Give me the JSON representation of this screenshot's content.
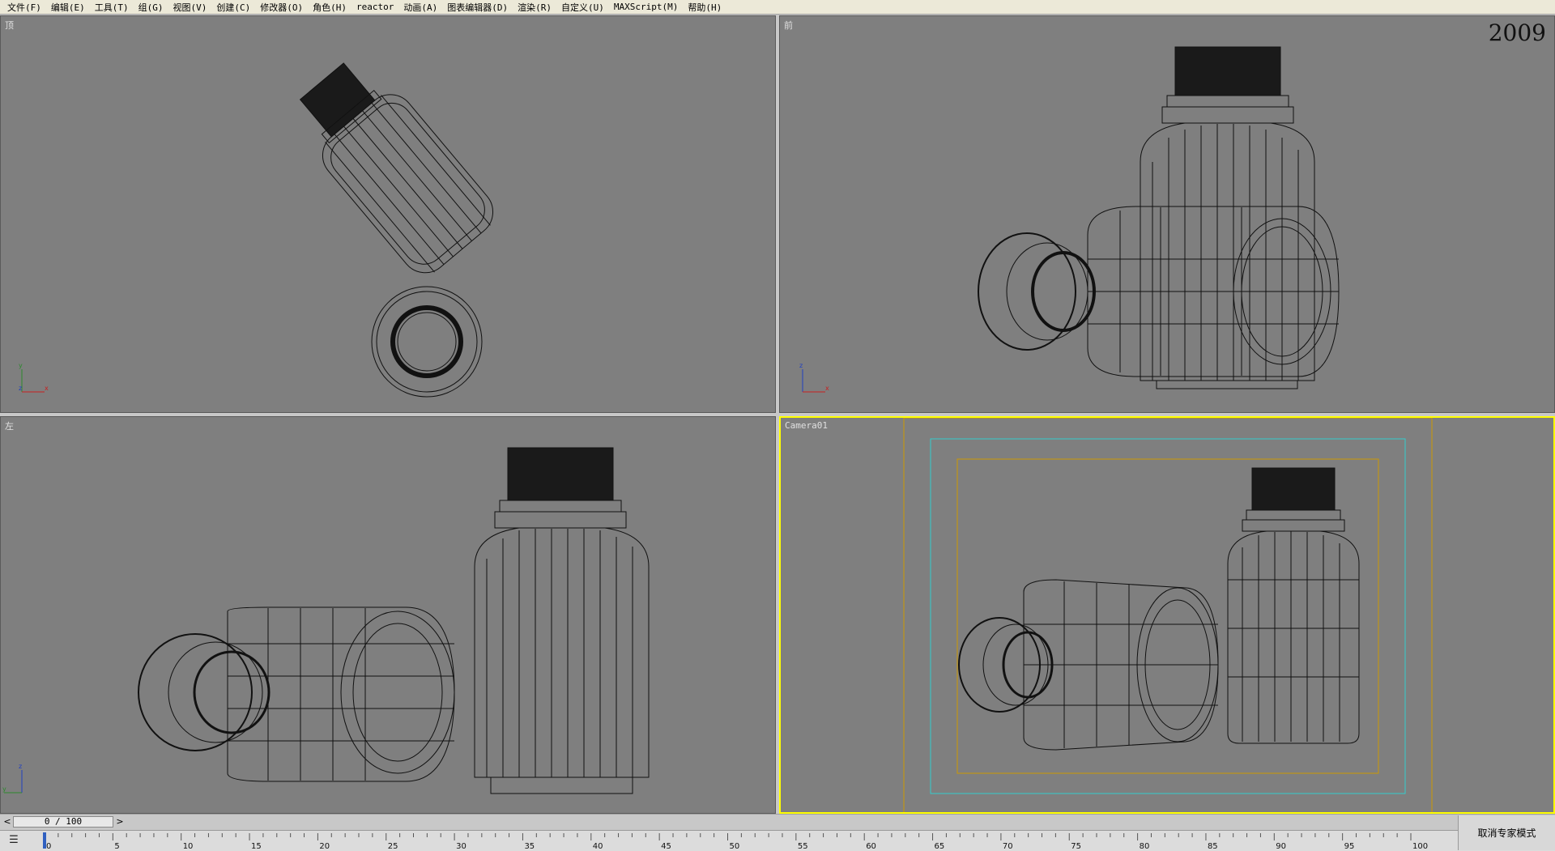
{
  "menu": {
    "items": [
      {
        "label": "文件(F)"
      },
      {
        "label": "编辑(E)"
      },
      {
        "label": "工具(T)"
      },
      {
        "label": "组(G)"
      },
      {
        "label": "视图(V)"
      },
      {
        "label": "创建(C)"
      },
      {
        "label": "修改器(O)"
      },
      {
        "label": "角色(H)"
      },
      {
        "label": "reactor"
      },
      {
        "label": "动画(A)"
      },
      {
        "label": "图表编辑器(D)"
      },
      {
        "label": "渲染(R)"
      },
      {
        "label": "自定义(U)"
      },
      {
        "label": "MAXScript(M)"
      },
      {
        "label": "帮助(H)"
      }
    ]
  },
  "viewports": {
    "top": {
      "label": "顶"
    },
    "front": {
      "label": "前",
      "year": "2009"
    },
    "left": {
      "label": "左"
    },
    "camera": {
      "label": "Camera01"
    }
  },
  "timeslider": {
    "frame": "0 / 100",
    "prev_icon": "<",
    "next_icon": ">"
  },
  "trackbar": {
    "ticks": [
      "0",
      "5",
      "10",
      "15",
      "20",
      "25",
      "30",
      "35",
      "40",
      "45",
      "50",
      "55",
      "60",
      "65",
      "70",
      "75",
      "80",
      "85",
      "90",
      "95",
      "100"
    ]
  },
  "expert_mode": {
    "label": "取消专家模式"
  },
  "colors": {
    "viewport_bg": "#7f7f7f",
    "active_border": "#ffff00",
    "safe_frame_cyan": "#33cccc",
    "safe_frame_orange": "#cc9900"
  }
}
